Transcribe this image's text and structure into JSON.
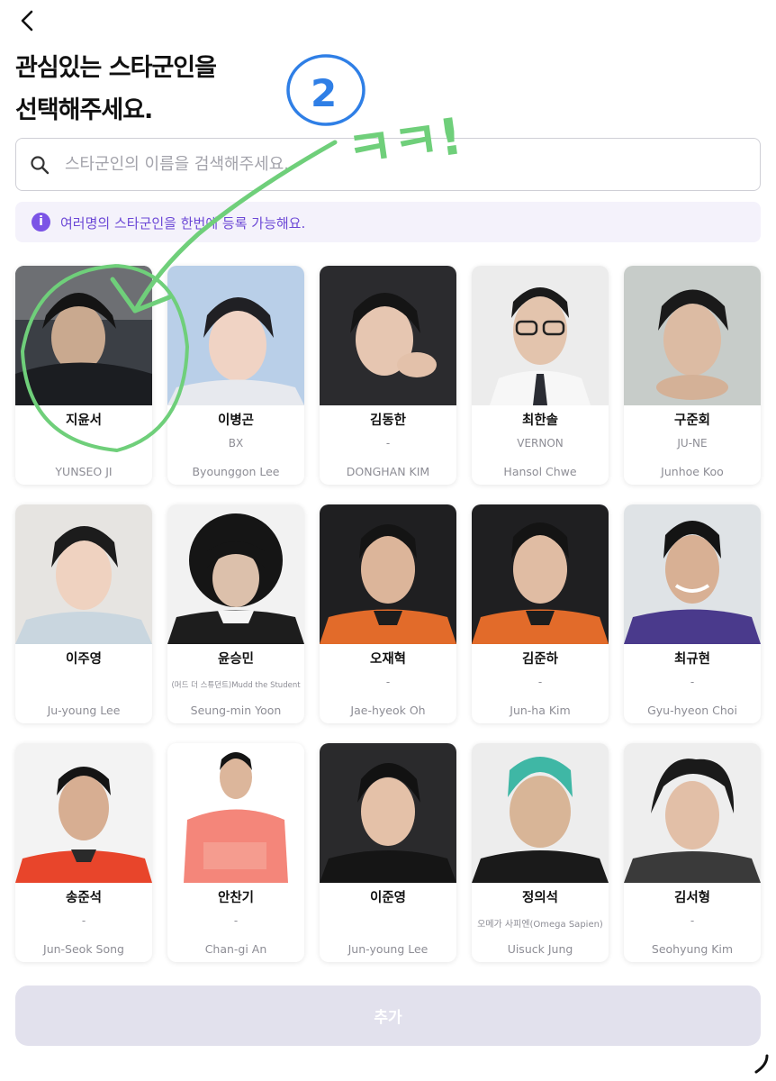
{
  "header": {
    "back_icon": "chevron-left-icon"
  },
  "title": {
    "line1": "관심있는 스타군인을",
    "line2": "선택해주세요."
  },
  "search": {
    "icon": "search-icon",
    "placeholder": "스타군인의 이름을 검색해주세요.",
    "value": ""
  },
  "info": {
    "icon": "info-icon",
    "icon_glyph": "i",
    "text": "여러명의 스타군인을 한번에 등록 가능해요."
  },
  "cards": [
    {
      "name": "지윤서",
      "sub": "",
      "eng": "YUNSEO JI"
    },
    {
      "name": "이병곤",
      "sub": "BX",
      "eng": "Byounggon Lee"
    },
    {
      "name": "김동한",
      "sub": "-",
      "eng": "DONGHAN KIM"
    },
    {
      "name": "최한솔",
      "sub": "VERNON",
      "eng": "Hansol Chwe"
    },
    {
      "name": "구준회",
      "sub": "JU-NE",
      "eng": "Junhoe Koo"
    },
    {
      "name": "이주영",
      "sub": "",
      "eng": "Ju-young Lee"
    },
    {
      "name": "윤승민",
      "sub": "(머드 더 스튜던트)Mudd the Student",
      "eng": "Seung-min Yoon"
    },
    {
      "name": "오재혁",
      "sub": "-",
      "eng": "Jae-hyeok Oh"
    },
    {
      "name": "김준하",
      "sub": "-",
      "eng": "Jun-ha Kim"
    },
    {
      "name": "최규현",
      "sub": "-",
      "eng": "Gyu-hyeon  Choi"
    },
    {
      "name": "송준석",
      "sub": "-",
      "eng": "Jun-Seok Song"
    },
    {
      "name": "안찬기",
      "sub": "-",
      "eng": "Chan-gi An"
    },
    {
      "name": "이준영",
      "sub": "",
      "eng": "Jun-young Lee"
    },
    {
      "name": "정의석",
      "sub": "오메가 사피엔(Omega Sapien)",
      "eng": "Uisuck Jung"
    },
    {
      "name": "김서형",
      "sub": "-",
      "eng": "Seohyung Kim"
    }
  ],
  "add_button": {
    "label": "추가"
  },
  "annotation": {
    "number": "2",
    "text": "ㅋㅋ!"
  },
  "colors": {
    "accent": "#7b54e6",
    "info_bg": "#f4f2fb",
    "button_disabled": "#e2e1ed",
    "marker_green": "#6fcf7a",
    "marker_blue": "#2f7fe6"
  }
}
